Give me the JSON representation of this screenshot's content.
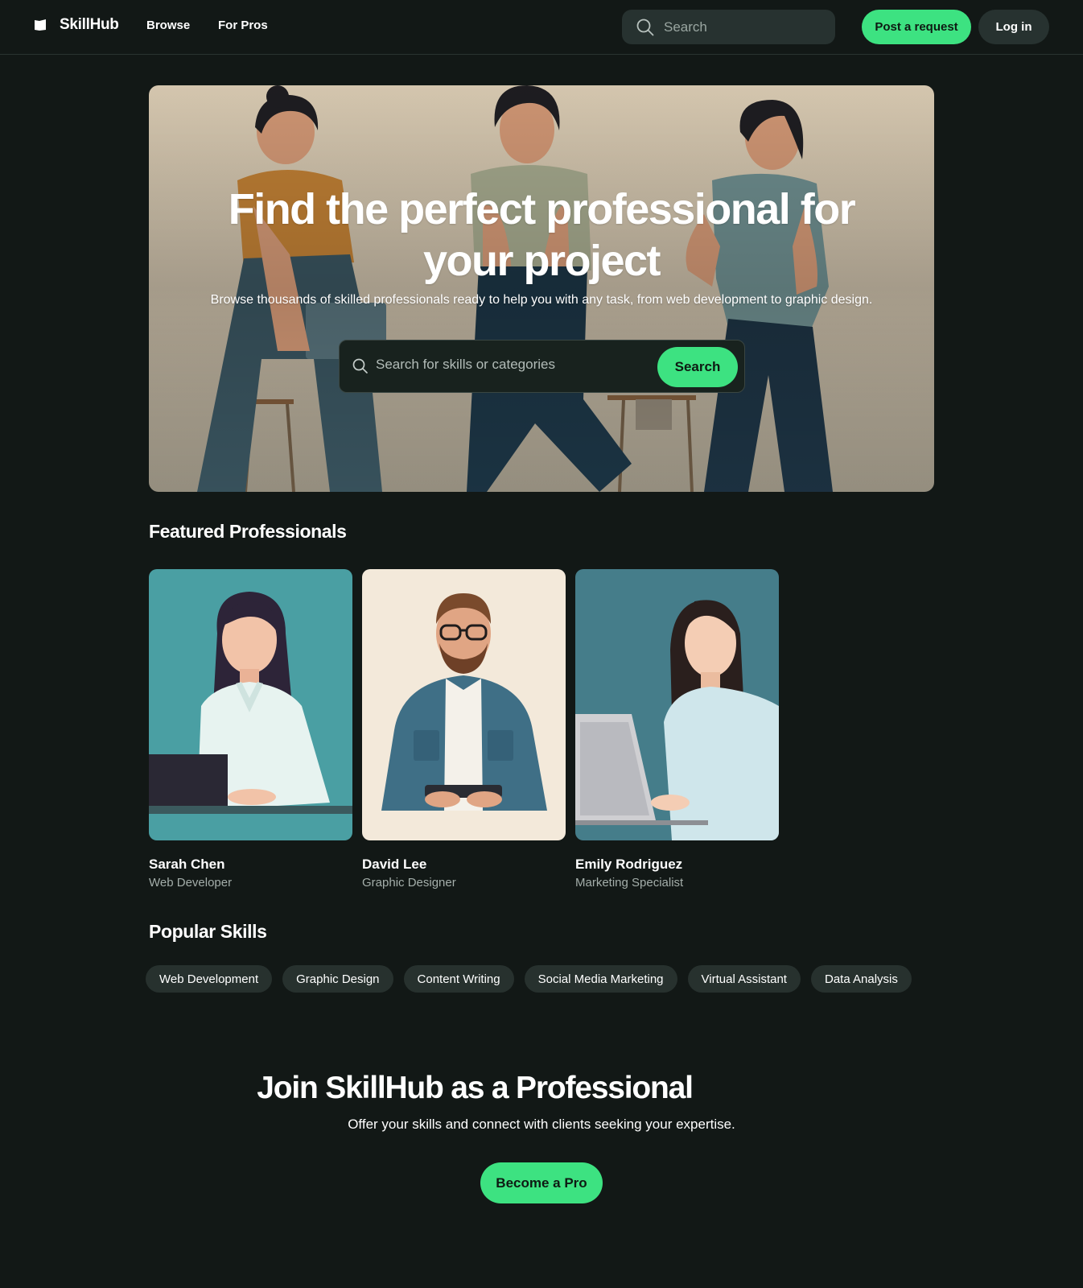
{
  "header": {
    "brand": "SkillHub",
    "nav": [
      {
        "label": "Browse"
      },
      {
        "label": "For Pros"
      }
    ],
    "search_placeholder": "Search",
    "post_label": "Post a request",
    "login_label": "Log in"
  },
  "hero": {
    "title": "Find the perfect professional for your project",
    "subtitle": "Browse thousands of skilled professionals ready to help you with any task, from web development to graphic design.",
    "search_placeholder": "Search for skills or categories",
    "search_button": "Search"
  },
  "featured": {
    "title": "Featured Professionals",
    "pros": [
      {
        "name": "Sarah Chen",
        "role": "Web Developer"
      },
      {
        "name": "David Lee",
        "role": "Graphic Designer"
      },
      {
        "name": "Emily Rodriguez",
        "role": "Marketing Specialist"
      }
    ]
  },
  "skills": {
    "title": "Popular Skills",
    "items": [
      {
        "label": "Web Development"
      },
      {
        "label": "Graphic Design"
      },
      {
        "label": "Content Writing"
      },
      {
        "label": "Social Media Marketing"
      },
      {
        "label": "Virtual Assistant"
      },
      {
        "label": "Data Analysis"
      }
    ]
  },
  "join": {
    "title": "Join SkillHub as a Professional",
    "subtitle": "Offer your skills and connect with clients seeking your expertise.",
    "button": "Become a Pro"
  },
  "colors": {
    "background": "#121816",
    "accent": "#3de281",
    "surface": "#273230",
    "muted_text": "#a4aeaa"
  }
}
